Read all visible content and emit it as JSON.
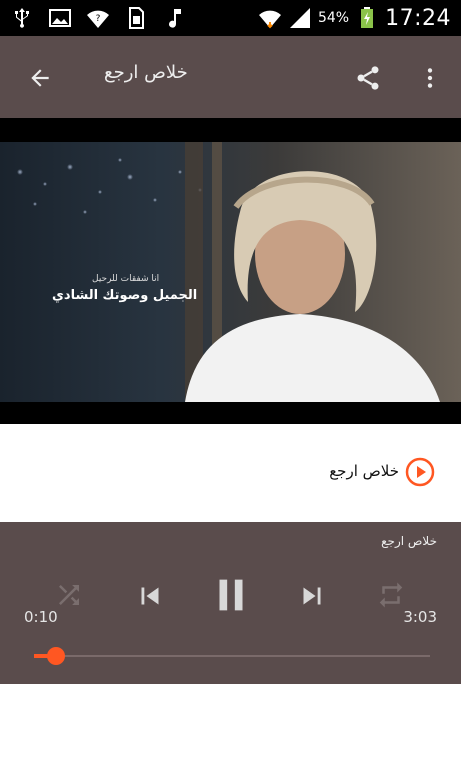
{
  "status_bar": {
    "icons": [
      "usb-icon",
      "image-icon",
      "wifi-question-icon",
      "sim-icon",
      "music-note-icon",
      "wifi-icon",
      "signal-icon",
      "battery-charging-icon"
    ],
    "battery": "54%",
    "time": "17:24"
  },
  "app_bar": {
    "title": "خلاص ارجع",
    "back_icon": "arrow-left-icon",
    "share_icon": "share-icon",
    "menu_icon": "more-vert-icon"
  },
  "video": {
    "overlay_line1": "انا شفقات للرحيل",
    "overlay_line2": "الجميل وصوتك الشادي"
  },
  "track": {
    "title": "خلاص ارجع",
    "icon": "play-circle-icon",
    "accent": "#ff5722"
  },
  "player": {
    "title": "خلاص ارجع",
    "current_time": "0:10",
    "total_time": "3:03",
    "progress": 0.055,
    "controls": [
      "shuffle-icon",
      "skip-previous-icon",
      "pause-icon",
      "skip-next-icon",
      "repeat-icon"
    ],
    "background": "#5a4c4c"
  }
}
